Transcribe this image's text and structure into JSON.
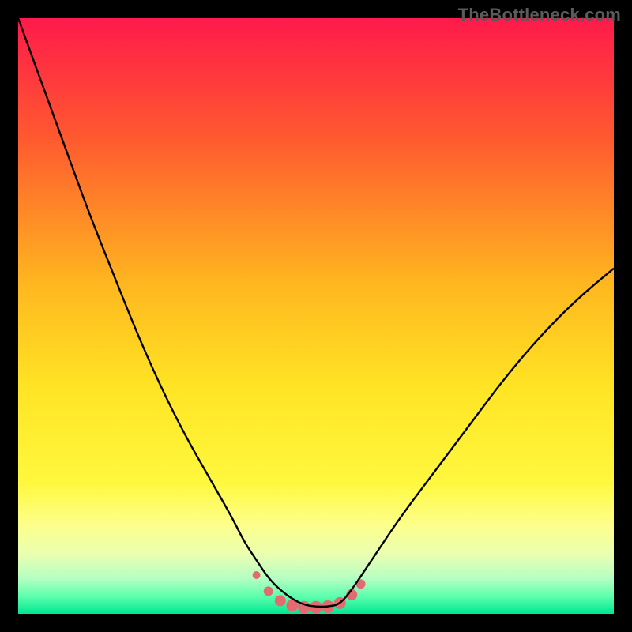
{
  "watermark": "TheBottleneck.com",
  "chart_data": {
    "type": "line",
    "title": "",
    "xlabel": "",
    "ylabel": "",
    "xlim": [
      0,
      100
    ],
    "ylim": [
      0,
      100
    ],
    "grid": false,
    "legend": false,
    "gradient_stops": [
      {
        "offset": 0.0,
        "color": "#ff1a4b"
      },
      {
        "offset": 0.2,
        "color": "#ff592f"
      },
      {
        "offset": 0.45,
        "color": "#ffb81f"
      },
      {
        "offset": 0.62,
        "color": "#ffe424"
      },
      {
        "offset": 0.78,
        "color": "#fff83e"
      },
      {
        "offset": 0.85,
        "color": "#fdff8a"
      },
      {
        "offset": 0.9,
        "color": "#eaffb0"
      },
      {
        "offset": 0.94,
        "color": "#b6ffc3"
      },
      {
        "offset": 0.97,
        "color": "#5fffad"
      },
      {
        "offset": 1.0,
        "color": "#00e792"
      }
    ],
    "series": [
      {
        "name": "bottleneck-curve",
        "color": "#000000",
        "x": [
          0,
          4,
          8,
          12,
          16,
          20,
          24,
          28,
          32,
          36,
          38,
          40,
          42,
          44,
          46,
          48,
          50,
          52,
          54,
          56,
          60,
          64,
          70,
          76,
          82,
          88,
          94,
          100
        ],
        "y": [
          100,
          89,
          78,
          67,
          57,
          47,
          38,
          30,
          23,
          16,
          12,
          9,
          6,
          4,
          2.5,
          1.5,
          1.2,
          1.2,
          1.6,
          4,
          10,
          16,
          24,
          32,
          40,
          47,
          53,
          58
        ]
      }
    ],
    "markers": {
      "name": "bottom-cluster",
      "color": "#e36a6f",
      "x": [
        40,
        42,
        44,
        46,
        48,
        50,
        52,
        54,
        56,
        57.5
      ],
      "y": [
        6.5,
        3.8,
        2.2,
        1.4,
        1.1,
        1.1,
        1.2,
        1.8,
        3.2,
        5.0
      ],
      "r": [
        5,
        6,
        7,
        7.5,
        8,
        8,
        8,
        7.5,
        7,
        6
      ]
    }
  }
}
